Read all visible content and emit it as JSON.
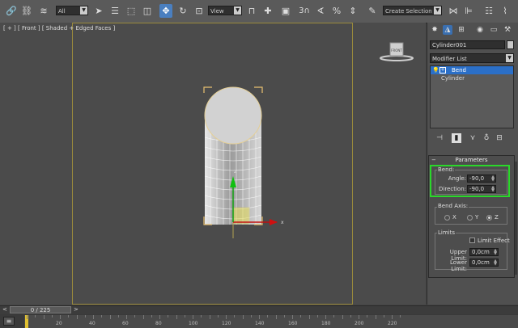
{
  "toolbar": {
    "selection_filter": "All",
    "reference_coord": "View",
    "snap_label": "3",
    "named_selection": "Create Selection Se",
    "icons": [
      "link-icon",
      "unlink-icon",
      "bind-spacewarp-icon",
      "select-object-icon",
      "select-by-name-icon",
      "rect-selection-icon",
      "window-crossing-icon",
      "move-icon",
      "rotate-icon",
      "scale-icon",
      "pivot-icon",
      "snap-icon",
      "angle-snap-icon",
      "percent-snap-icon",
      "spinner-snap-icon",
      "edit-named-sets-icon",
      "mirror-icon",
      "align-icon",
      "layer-icon",
      "curve-editor-icon"
    ]
  },
  "viewport": {
    "label": "[ + ] [ Front ] [ Shaded + Edged Faces ]",
    "viewcube_label": "FRONT",
    "gizmo_axis_x": "x",
    "gizmo_axis_z": "z"
  },
  "panel": {
    "tabs": [
      "create-tab-icon",
      "modify-tab-icon",
      "hierarchy-tab-icon",
      "motion-tab-icon",
      "display-tab-icon",
      "utilities-tab-icon"
    ],
    "object_name": "Cylinder001",
    "modifier_list": "Modifier List",
    "stack": [
      {
        "label": "Bend",
        "selected": true
      },
      {
        "label": "Cylinder",
        "selected": false
      }
    ],
    "parameters_title": "Parameters",
    "bend_group": "Bend:",
    "angle_label": "Angle:",
    "angle_value": "-90,0",
    "direction_label": "Direction:",
    "direction_value": "-90,0",
    "bend_axis_group": "Bend Axis:",
    "axes": [
      {
        "label": "X",
        "on": false
      },
      {
        "label": "Y",
        "on": false
      },
      {
        "label": "Z",
        "on": true
      }
    ],
    "limits_group": "Limits",
    "limit_effect": "Limit Effect",
    "upper_limit_label": "Upper Limit:",
    "upper_limit_value": "0,0cm",
    "lower_limit_label": "Lower Limit:",
    "lower_limit_value": "0,0cm",
    "highlight_color": "#2ad82a"
  },
  "timeline": {
    "frame_readout": "0 / 225",
    "tick_labels": [
      "20",
      "40",
      "60",
      "80",
      "100",
      "120",
      "140",
      "160",
      "180",
      "200",
      "220"
    ]
  }
}
